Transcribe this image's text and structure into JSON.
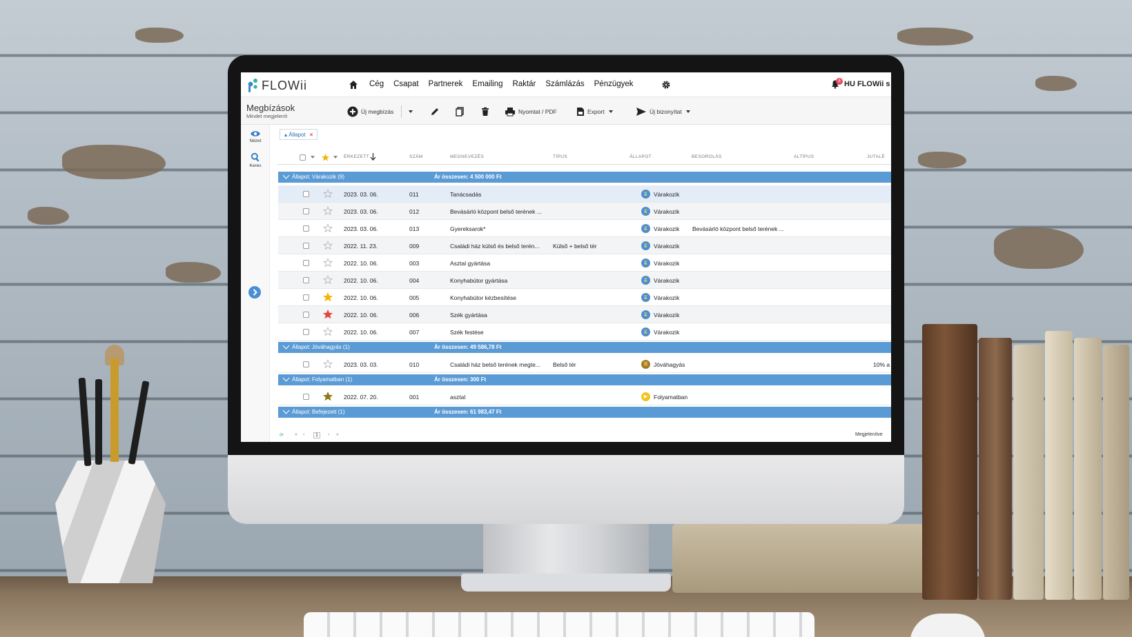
{
  "app": {
    "logo_text": "FLOWii",
    "company": "HU FLOWii s",
    "notification_count": "8"
  },
  "nav": {
    "items": [
      "Cég",
      "Csapat",
      "Partnerek",
      "Emailing",
      "Raktár",
      "Számlázás",
      "Pénzügyek"
    ]
  },
  "page": {
    "title": "Megbízások",
    "subtitle": "Mindet megjelenít"
  },
  "toolbar": {
    "new_label": "Új megbízás",
    "print_label": "Nyomtat / PDF",
    "export_label": "Export",
    "new_doc_label": "Új bizonyítat"
  },
  "sidebar": {
    "view_label": "Nézet",
    "search_label": "Keres"
  },
  "filter": {
    "label": "Állapot"
  },
  "columns": [
    "ÉRKEZETT",
    "SZÁM",
    "MEGNEVEZÉS",
    "TÍPUS",
    "ÁLLAPOT",
    "BESOROLÁS",
    "ALTÍPUS",
    "JUTALÉ"
  ],
  "groups": [
    {
      "label": "Állapot: Várakozik (9)",
      "sum": "Ár összesen: 4 500 000 Ft",
      "rows": [
        {
          "date": "2023. 03. 06.",
          "num": "011",
          "name": "Tanácsadás",
          "type": "",
          "status": "Várakozik",
          "class": "",
          "extra": "",
          "star": "none"
        },
        {
          "date": "2023. 03. 06.",
          "num": "012",
          "name": "Bevásárló központ belső terének ...",
          "type": "",
          "status": "Várakozik",
          "class": "",
          "extra": "",
          "star": "none"
        },
        {
          "date": "2023. 03. 06.",
          "num": "013",
          "name": "Gyereksarok*",
          "type": "",
          "status": "Várakozik",
          "class": "Bevásárló központ belső terének ...",
          "extra": "",
          "star": "none"
        },
        {
          "date": "2022. 11. 23.",
          "num": "009",
          "name": "Családi ház külső és belső terén...",
          "type": "Külső + belső tér",
          "status": "Várakozik",
          "class": "",
          "extra": "",
          "star": "none"
        },
        {
          "date": "2022. 10. 06.",
          "num": "003",
          "name": "Asztal gyártása",
          "type": "",
          "status": "Várakozik",
          "class": "",
          "extra": "",
          "star": "none"
        },
        {
          "date": "2022. 10. 06.",
          "num": "004",
          "name": "Konyhabútor gyártása",
          "type": "",
          "status": "Várakozik",
          "class": "",
          "extra": "",
          "star": "none"
        },
        {
          "date": "2022. 10. 06.",
          "num": "005",
          "name": "Konyhabútor kézbesítése",
          "type": "",
          "status": "Várakozik",
          "class": "",
          "extra": "",
          "star": "gold"
        },
        {
          "date": "2022. 10. 06.",
          "num": "006",
          "name": "Szék gyártása",
          "type": "",
          "status": "Várakozik",
          "class": "",
          "extra": "",
          "star": "red"
        },
        {
          "date": "2022. 10. 06.",
          "num": "007",
          "name": "Szék festése",
          "type": "",
          "status": "Várakozik",
          "class": "",
          "extra": "",
          "star": "none"
        }
      ]
    },
    {
      "label": "Állapot: Jóváhagyás (1)",
      "sum": "Ár összesen: 49 586,78 Ft",
      "rows": [
        {
          "date": "2023. 03. 03.",
          "num": "010",
          "name": "Családi ház belső terének megte...",
          "type": "Belső tér",
          "status": "Jóváhagyás",
          "class": "",
          "extra": "10% a",
          "star": "none"
        }
      ]
    },
    {
      "label": "Állapot: Folyamatban (1)",
      "sum": "Ár összesen: 300 Ft",
      "rows": [
        {
          "date": "2022. 07. 20.",
          "num": "001",
          "name": "asztal",
          "type": "",
          "status": "Folyamatban",
          "class": "",
          "extra": "",
          "star": "olive"
        }
      ]
    },
    {
      "label": "Állapot: Befejezett (1)",
      "sum": "Ár összesen: 61 983,47 Ft",
      "rows": []
    }
  ],
  "pager": {
    "page": "1",
    "right_label": "Megjelenítve"
  },
  "colors": {
    "group_bar": "#5b9bd5",
    "accent": "#4a8fd3",
    "status_waiting": "#4a8fd3",
    "status_approval": "#a77c1a",
    "status_progress": "#f2c318",
    "star_gold": "#f2b705",
    "star_red": "#e2463c",
    "star_olive": "#8a7a18"
  }
}
